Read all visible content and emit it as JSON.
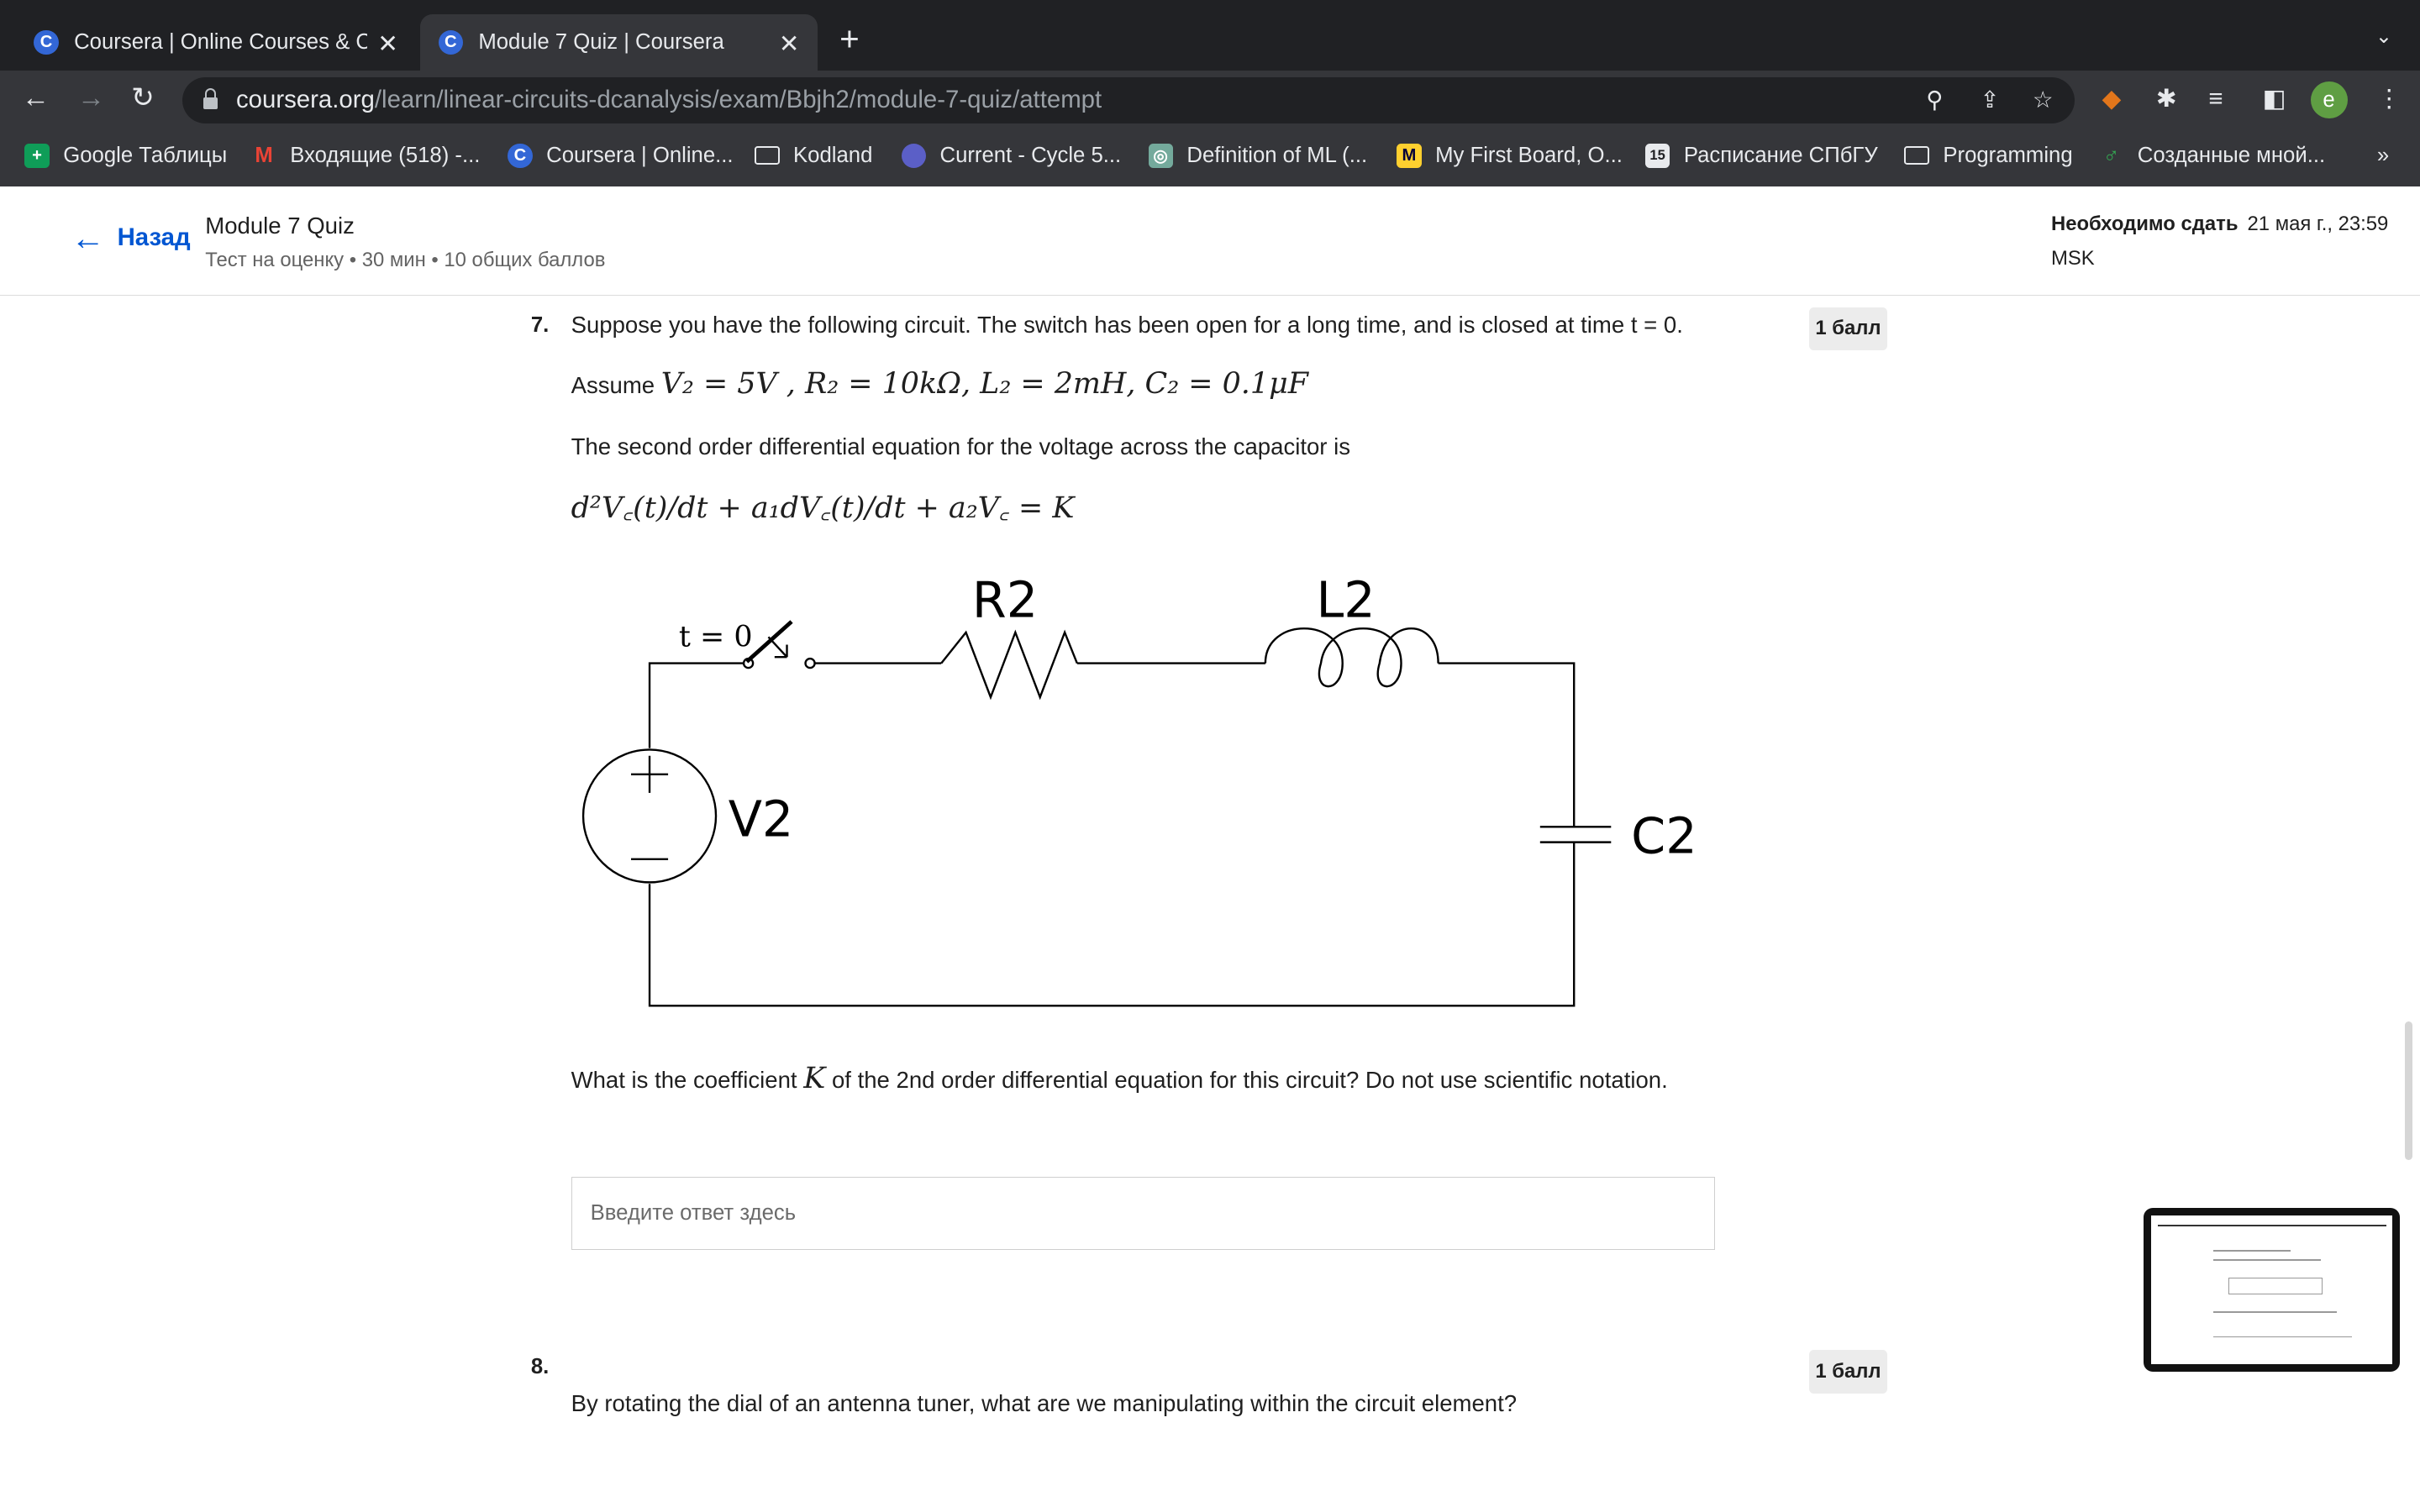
{
  "browser": {
    "tabs": [
      {
        "title": "Coursera | Online Courses & Cr",
        "favicon": "C"
      },
      {
        "title": "Module 7 Quiz | Coursera",
        "favicon": "C"
      }
    ],
    "url_host": "coursera.org",
    "url_path": "/learn/linear-circuits-dcanalysis/exam/Bbjh2/module-7-quiz/attempt",
    "profile_initial": "e",
    "bookmarks": [
      {
        "label": "Google Таблицы",
        "icon": "sheets-icon",
        "color": "#0f9d58",
        "glyph": "+"
      },
      {
        "label": "Входящие (518) -...",
        "icon": "gmail-icon",
        "color": "#ea4335",
        "glyph": "M"
      },
      {
        "label": "Coursera | Online...",
        "icon": "coursera-icon",
        "color": "#3367d6",
        "glyph": "C"
      },
      {
        "label": "Kodland",
        "icon": "folder-icon",
        "color": "",
        "glyph": ""
      },
      {
        "label": "Current - Cycle 5...",
        "icon": "globe-icon",
        "color": "#5b5fc7",
        "glyph": ""
      },
      {
        "label": "Definition of ML (...",
        "icon": "openai-icon",
        "color": "#74aa9c",
        "glyph": "◎"
      },
      {
        "label": "My First Board, O...",
        "icon": "miro-icon",
        "color": "#ffd02f",
        "glyph": "M"
      },
      {
        "label": "Расписание СПбГУ",
        "icon": "calendar-icon",
        "color": "#e8eaed",
        "glyph": "15"
      },
      {
        "label": "Programming",
        "icon": "folder-icon",
        "color": "",
        "glyph": ""
      },
      {
        "label": "Созданные мной...",
        "icon": "leaf-icon",
        "color": "#34a853",
        "glyph": "♂"
      }
    ]
  },
  "header": {
    "back_label": "Назад",
    "quiz_title": "Module 7 Quiz",
    "quiz_meta": "Тест на оценку • 30 мин • 10 общих баллов",
    "due_label": "Необходимо сдать",
    "due_date": "21 мая г., 23:59",
    "timezone": "MSK"
  },
  "question7": {
    "number": "7.",
    "points": "1 балл",
    "text": "Suppose you have the following circuit. The switch has been open for a long time, and is closed at time t = 0.",
    "assume_word": "Assume",
    "assume_math": "V₂ = 5V , R₂ = 10kΩ, L₂ = 2mH, C₂ = 0.1μF",
    "eq_intro": "The second order differential equation for the voltage across the capacitor is",
    "equation": "d²V꜀(t)/dt + a₁dV꜀(t)/dt + a₂V꜀ = K",
    "circuit": {
      "switch_label": "t = 0",
      "resistor_label": "R2",
      "inductor_label": "L2",
      "source_label": "V2",
      "capacitor_label": "C2"
    },
    "ask_before": "What is the coefficient",
    "ask_var": "K",
    "ask_after": "of the 2nd order differential equation for this circuit? Do not use scientific notation.",
    "answer_placeholder": "Введите ответ здесь"
  },
  "question8": {
    "number": "8.",
    "points": "1 балл",
    "text": "By rotating the dial of an antenna tuner, what are we manipulating within the circuit element?"
  }
}
